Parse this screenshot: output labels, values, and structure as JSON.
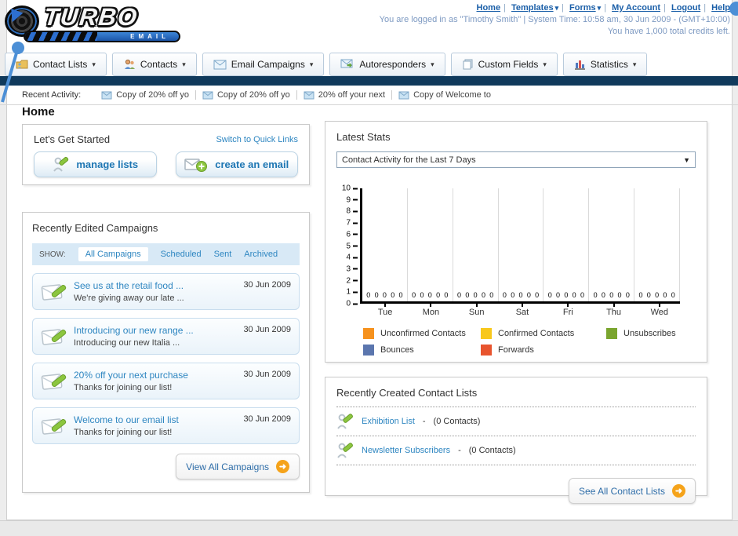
{
  "header": {
    "logo": {
      "title": "TURBO",
      "subtitle": "EMAIL"
    },
    "links": [
      {
        "label": "Home"
      },
      {
        "label": "Templates",
        "dropdown": true
      },
      {
        "label": "Forms",
        "dropdown": true
      },
      {
        "label": "My Account"
      },
      {
        "label": "Logout"
      },
      {
        "label": "Help"
      }
    ],
    "login_text": "You are logged in as \"Timothy Smith\" | System Time: 10:58 am, 30 Jun 2009 - (GMT+10:00)",
    "credits_text": "You have 1,000 total credits left."
  },
  "icons": {
    "dropdown_arrow": "▾",
    "select_arrow": "▼",
    "forward_arrow": "➜"
  },
  "nav": {
    "items": [
      {
        "label": "Contact Lists"
      },
      {
        "label": "Contacts"
      },
      {
        "label": "Email Campaigns"
      },
      {
        "label": "Autoresponders"
      },
      {
        "label": "Custom Fields"
      },
      {
        "label": "Statistics"
      }
    ]
  },
  "recent_activity": {
    "label": "Recent Activity:",
    "items": [
      {
        "label": "Copy of 20% off yo"
      },
      {
        "label": "Copy of 20% off yo"
      },
      {
        "label": "20% off your next"
      },
      {
        "label": "Copy of Welcome to"
      }
    ]
  },
  "page_title": "Home",
  "get_started": {
    "title": "Let's Get Started",
    "switch_link": "Switch to Quick Links",
    "manage_lists_label": "manage lists",
    "create_email_label": "create an email"
  },
  "campaigns": {
    "title": "Recently Edited Campaigns",
    "show_label": "SHOW:",
    "filters": [
      "All Campaigns",
      "Scheduled",
      "Sent",
      "Archived"
    ],
    "active_filter": "All Campaigns",
    "items": [
      {
        "title": "See us at the retail food ...",
        "subtitle": "We're giving away our late ...",
        "date": "30 Jun 2009"
      },
      {
        "title": "Introducing our new range ...",
        "subtitle": "Introducing our new Italia ...",
        "date": "30 Jun 2009"
      },
      {
        "title": "20% off your next purchase",
        "subtitle": "Thanks for joining our list!",
        "date": "30 Jun 2009"
      },
      {
        "title": "Welcome to our email list",
        "subtitle": "Thanks for joining our list!",
        "date": "30 Jun 2009"
      }
    ],
    "view_all_label": "View All Campaigns"
  },
  "stats": {
    "title": "Latest Stats",
    "selector_value": "Contact Activity for the Last 7 Days",
    "chart_data": {
      "type": "bar",
      "title": "Contact Activity for the Last 7 Days",
      "categories": [
        "Tue",
        "Mon",
        "Sun",
        "Sat",
        "Fri",
        "Thu",
        "Wed"
      ],
      "series": [
        {
          "name": "Unconfirmed Contacts",
          "color": "#F6921E",
          "values": [
            0,
            0,
            0,
            0,
            0,
            0,
            0
          ]
        },
        {
          "name": "Confirmed Contacts",
          "color": "#F8C81C",
          "values": [
            0,
            0,
            0,
            0,
            0,
            0,
            0
          ]
        },
        {
          "name": "Unsubscribes",
          "color": "#7AA52E",
          "values": [
            0,
            0,
            0,
            0,
            0,
            0,
            0
          ]
        },
        {
          "name": "Bounces",
          "color": "#5B76AE",
          "values": [
            0,
            0,
            0,
            0,
            0,
            0,
            0
          ]
        },
        {
          "name": "Forwards",
          "color": "#E8542E",
          "values": [
            0,
            0,
            0,
            0,
            0,
            0,
            0
          ]
        }
      ],
      "ylim": [
        0,
        10
      ],
      "ytick_step": 1,
      "grid": "vertical",
      "legend_position": "bottom"
    }
  },
  "contact_lists": {
    "title": "Recently Created Contact Lists",
    "items": [
      {
        "name": "Exhibition List",
        "sep": "-",
        "count": "(0 Contacts)"
      },
      {
        "name": "Newsletter Subscribers",
        "sep": "-",
        "count": "(0 Contacts)"
      }
    ],
    "see_all_label": "See All Contact Lists"
  }
}
